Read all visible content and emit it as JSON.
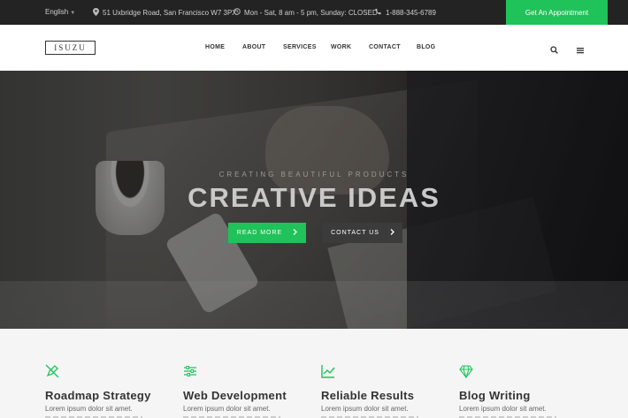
{
  "topbar": {
    "language": "English",
    "address": "51 Uxbridge Road, San Francisco W7 3PX",
    "hours": "Mon - Sat, 8 am - 5 pm, Sunday: CLOSED",
    "phone": "1-888-345-6789",
    "appointment_label": "Get An Appointment",
    "accent_color": "#20c25a"
  },
  "navbar": {
    "logo": "ISUZU",
    "items": [
      {
        "label": "HOME"
      },
      {
        "label": "ABOUT"
      },
      {
        "label": "SERVICES"
      },
      {
        "label": "WORK"
      },
      {
        "label": "CONTACT"
      },
      {
        "label": "BLOG"
      }
    ],
    "search_icon": "search-icon",
    "menu_icon": "menu-icon"
  },
  "hero": {
    "eyebrow": "CREATING BEAUTIFUL PRODUCTS",
    "headline": "CREATIVE IDEAS",
    "primary_button": "READ MORE",
    "secondary_button": "CONTACT US"
  },
  "features": [
    {
      "icon": "no-pen-icon",
      "title": "Roadmap Strategy",
      "text": "Lorem ipsum dolor sit amet."
    },
    {
      "icon": "sliders-icon",
      "title": "Web Development",
      "text": "Lorem ipsum dolor sit amet."
    },
    {
      "icon": "trend-chart-icon",
      "title": "Reliable Results",
      "text": "Lorem ipsum dolor sit amet."
    },
    {
      "icon": "diamond-icon",
      "title": "Blog Writing",
      "text": "Lorem ipsum dolor sit amet."
    }
  ]
}
